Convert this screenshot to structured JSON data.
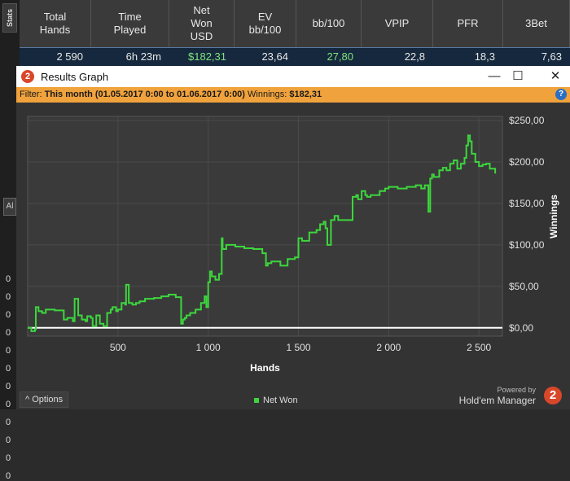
{
  "sidebar": {
    "stats_tab": "Stats",
    "box_text": "Al",
    "rows": [
      "0",
      "0",
      "0",
      "0",
      "0",
      "0",
      "0",
      "0",
      "0",
      "0",
      "0",
      "0"
    ]
  },
  "stats_table": {
    "headers": [
      "Total\nHands",
      "Time\nPlayed",
      "Net\nWon\nUSD",
      "EV\nbb/100",
      "bb/100",
      "VPIP",
      "PFR",
      "3Bet"
    ],
    "row": [
      "2 590",
      "6h 23m",
      "$182,31",
      "23,64",
      "27,80",
      "22,8",
      "18,3",
      "7,63"
    ]
  },
  "window": {
    "title": "Results Graph",
    "icon_text": "2",
    "minimize": "—",
    "maximize": "☐",
    "close": "✕"
  },
  "filter": {
    "label": "Filter:",
    "period": "This month (01.05.2017 0:00 to 01.06.2017 0:00)",
    "winnings_label": "Winnings:",
    "winnings_value": "$182,31",
    "help": "?"
  },
  "chart_data": {
    "type": "line",
    "xlabel": "Hands",
    "ylabel": "Winnings",
    "xlim": [
      0,
      2630
    ],
    "ylim": [
      -10,
      255
    ],
    "x_ticks": [
      500,
      1000,
      1500,
      2000,
      2500
    ],
    "x_tick_labels": [
      "500",
      "1 000",
      "1 500",
      "2 000",
      "2 500"
    ],
    "y_ticks": [
      0,
      50,
      100,
      150,
      200,
      250
    ],
    "y_tick_labels": [
      "$0,00",
      "$50,00",
      "$100,00",
      "$150,00",
      "$200,00",
      "$250,00"
    ],
    "series": [
      {
        "name": "Net Won",
        "color": "#3dd63d",
        "x": [
          0,
          20,
          40,
          45,
          60,
          80,
          100,
          150,
          200,
          220,
          250,
          260,
          280,
          300,
          320,
          330,
          350,
          360,
          380,
          400,
          420,
          440,
          460,
          470,
          490,
          500,
          520,
          540,
          545,
          560,
          580,
          600,
          620,
          650,
          700,
          740,
          780,
          820,
          850,
          860,
          870,
          880,
          900,
          930,
          960,
          980,
          990,
          1000,
          1010,
          1020,
          1040,
          1060,
          1075,
          1080,
          1100,
          1150,
          1200,
          1250,
          1300,
          1320,
          1330,
          1350,
          1400,
          1440,
          1480,
          1500,
          1520,
          1560,
          1600,
          1620,
          1640,
          1650,
          1660,
          1680,
          1700,
          1720,
          1780,
          1800,
          1820,
          1830,
          1850,
          1870,
          1880,
          1900,
          1950,
          1980,
          2000,
          2050,
          2100,
          2150,
          2180,
          2200,
          2220,
          2230,
          2240,
          2250,
          2280,
          2300,
          2320,
          2340,
          2360,
          2380,
          2400,
          2420,
          2430,
          2440,
          2450,
          2460,
          2480,
          2500,
          2520,
          2540,
          2560,
          2590
        ],
        "values": [
          0,
          -4,
          -2,
          25,
          20,
          18,
          22,
          21,
          10,
          12,
          8,
          35,
          15,
          10,
          8,
          14,
          12,
          2,
          15,
          5,
          2,
          18,
          22,
          25,
          20,
          22,
          30,
          28,
          52,
          30,
          28,
          30,
          32,
          35,
          36,
          38,
          40,
          37,
          5,
          10,
          12,
          15,
          18,
          22,
          30,
          38,
          25,
          55,
          68,
          62,
          58,
          65,
          108,
          95,
          100,
          98,
          96,
          95,
          90,
          75,
          78,
          80,
          75,
          83,
          85,
          108,
          105,
          115,
          118,
          125,
          128,
          120,
          100,
          130,
          135,
          130,
          130,
          158,
          160,
          155,
          165,
          160,
          158,
          160,
          165,
          168,
          170,
          168,
          170,
          172,
          168,
          172,
          140,
          180,
          185,
          182,
          190,
          193,
          190,
          198,
          202,
          192,
          198,
          205,
          220,
          232,
          225,
          210,
          200,
          195,
          197,
          198,
          192,
          186
        ]
      }
    ]
  },
  "footer": {
    "options_label": "Options",
    "options_icon": "^",
    "legend_label": "Net Won",
    "powered_by": "Powered by",
    "brand_name": "Hold'em Manager",
    "brand_logo": "2"
  }
}
